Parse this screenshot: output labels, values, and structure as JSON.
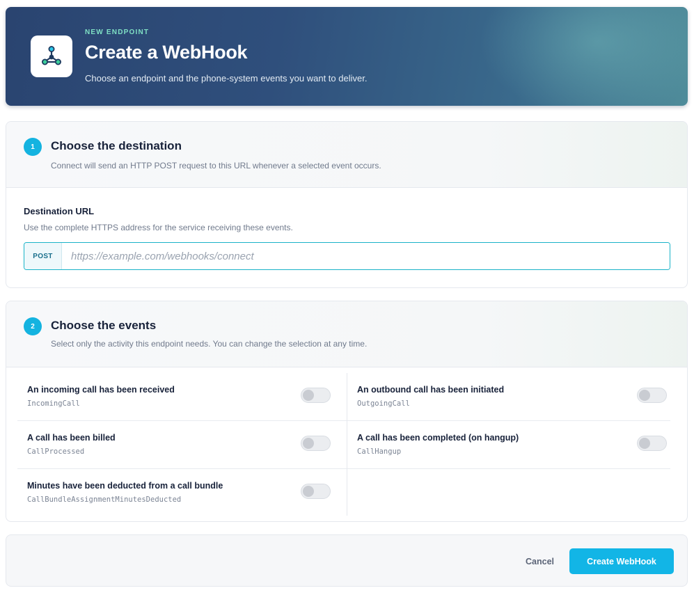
{
  "header": {
    "eyebrow": "NEW ENDPOINT",
    "title": "Create a WebHook",
    "subtitle": "Choose an endpoint and the phone-system events you want to deliver.",
    "logo_icon": "webhook-nodes-icon"
  },
  "destination": {
    "step": "1",
    "title": "Choose the destination",
    "description": "Connect will send an HTTP POST request to this URL whenever a selected event occurs.",
    "field_label": "Destination URL",
    "field_help": "Use the complete HTTPS address for the service receiving these events.",
    "method": "POST",
    "url_value": "",
    "url_placeholder": "https://example.com/webhooks/connect"
  },
  "events": {
    "step": "2",
    "title": "Choose the events",
    "description": "Select only the activity this endpoint needs. You can change the selection at any time.",
    "items": [
      {
        "title": "An incoming call has been received",
        "code": "IncomingCall",
        "enabled": false
      },
      {
        "title": "An outbound call has been initiated",
        "code": "OutgoingCall",
        "enabled": false
      },
      {
        "title": "A call has been billed",
        "code": "CallProcessed",
        "enabled": false
      },
      {
        "title": "A call has been completed (on hangup)",
        "code": "CallHangup",
        "enabled": false
      },
      {
        "title": "Minutes have been deducted from a call bundle",
        "code": "CallBundleAssignmentMinutesDeducted",
        "enabled": false
      }
    ]
  },
  "footer": {
    "cancel_label": "Cancel",
    "create_label": "Create WebHook"
  },
  "colors": {
    "accent": "#12b5e6",
    "header_bg": "#2f4f7c",
    "eyebrow": "#7fe0c4"
  }
}
